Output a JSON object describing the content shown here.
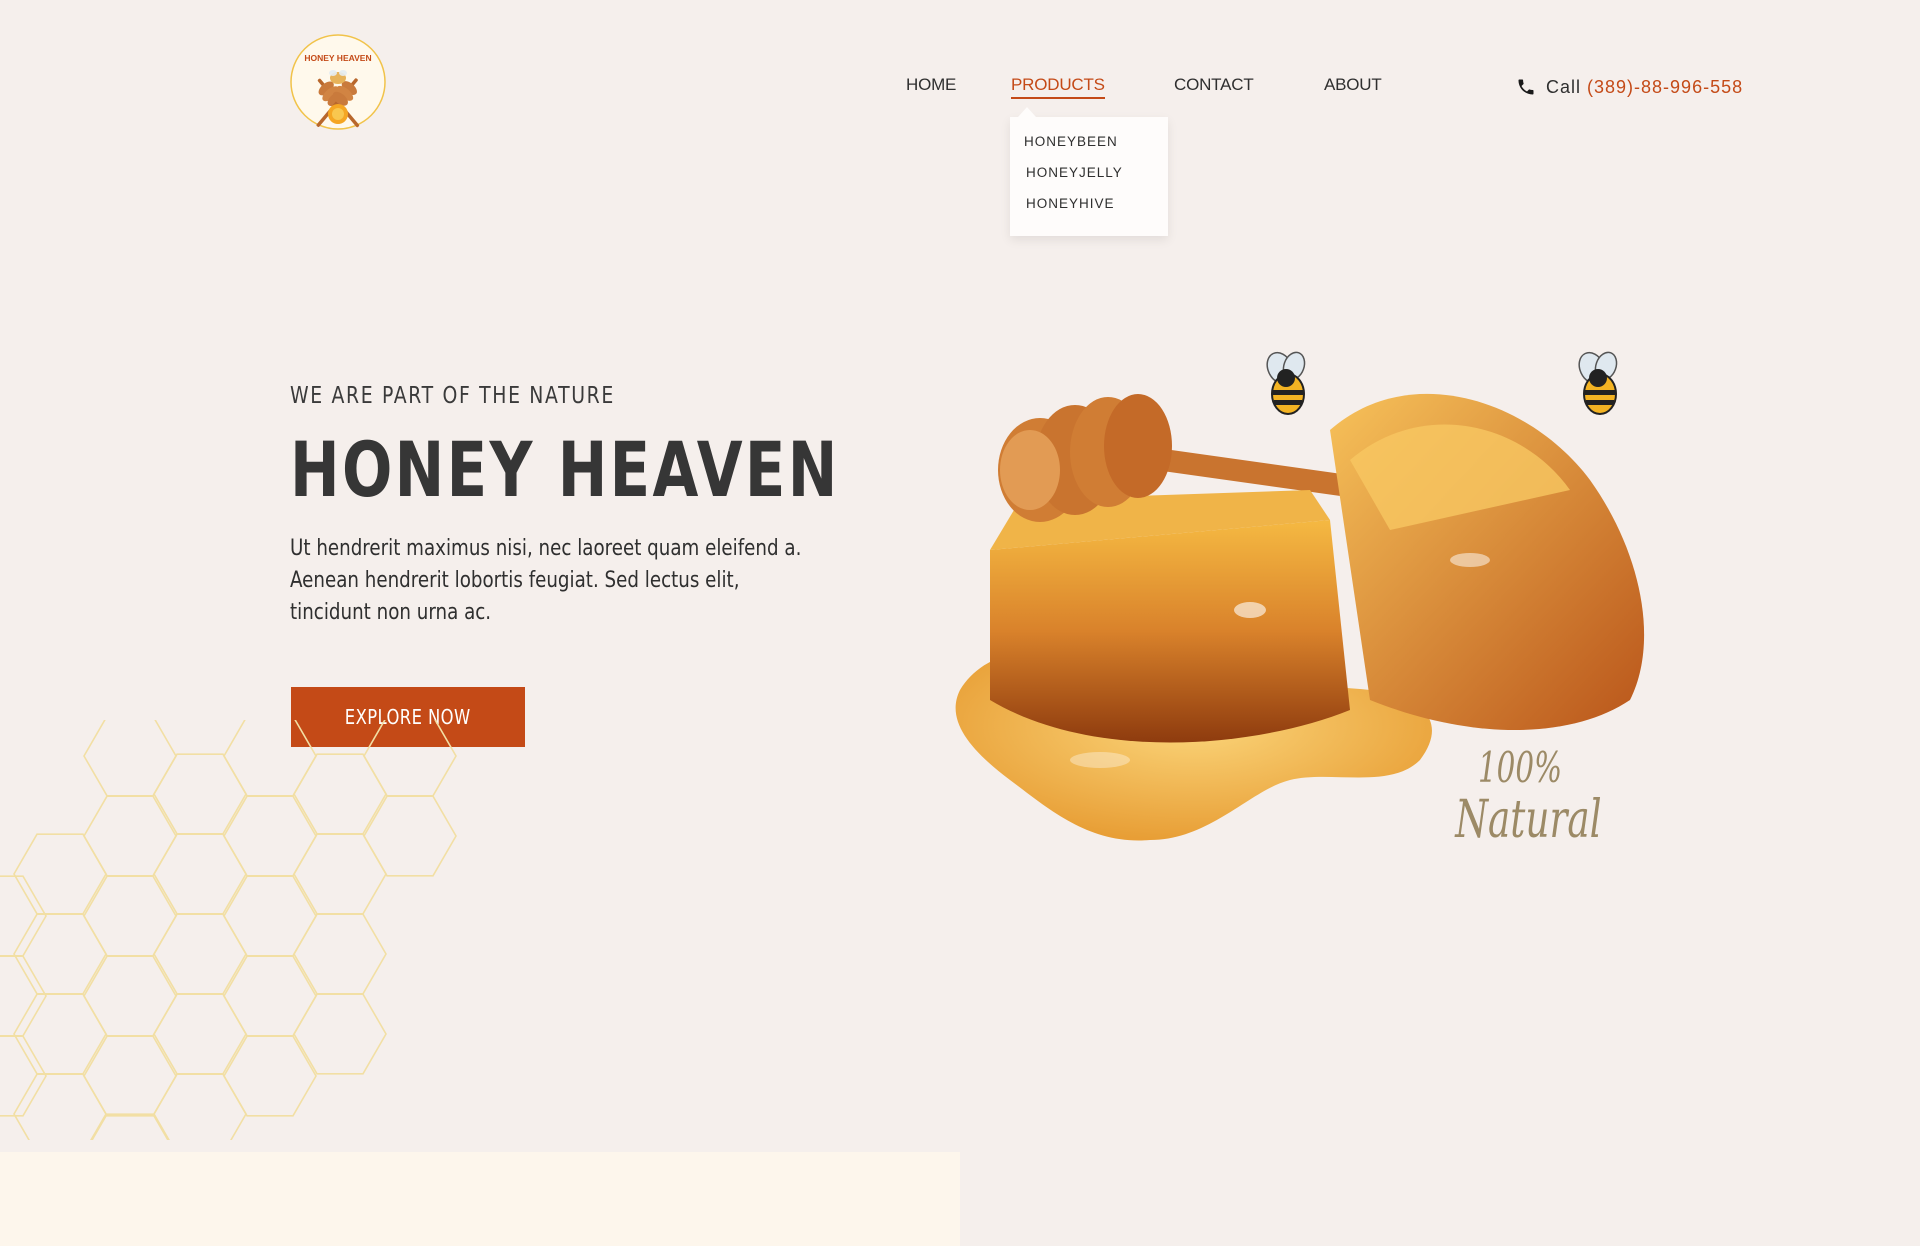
{
  "brand": {
    "logo_text": "HONEY HEAVEN"
  },
  "nav": {
    "items": [
      {
        "label": "HOME"
      },
      {
        "label": "PRODUCTS"
      },
      {
        "label": "CONTACT"
      },
      {
        "label": "ABOUT"
      }
    ],
    "active": "PRODUCTS",
    "dropdown": [
      {
        "label": "HONEYBEEN"
      },
      {
        "label": "HONEYJELLY"
      },
      {
        "label": "HONEYHIVE"
      }
    ]
  },
  "contact": {
    "call_label": "Call",
    "phone": "(389)-88-996-558",
    "icon": "phone-icon"
  },
  "hero": {
    "subtitle": "WE ARE PART OF THE NATURE",
    "title": "HONEY HEAVEN",
    "text": "Ut hendrerit maximus nisi, nec laoreet quam eleifend a. Aenean hendrerit lobortis feugiat. Sed lectus elit, tincidunt non urna ac.",
    "cta_label": "EXPLORE NOW",
    "badge_line1": "100%",
    "badge_line2": "Natural"
  },
  "colors": {
    "background": "#f5efec",
    "accent": "#c44a17",
    "text": "#2f2f2f",
    "hex_pattern": "#f2dfa4",
    "bottom_strip": "#fdf6ec"
  }
}
